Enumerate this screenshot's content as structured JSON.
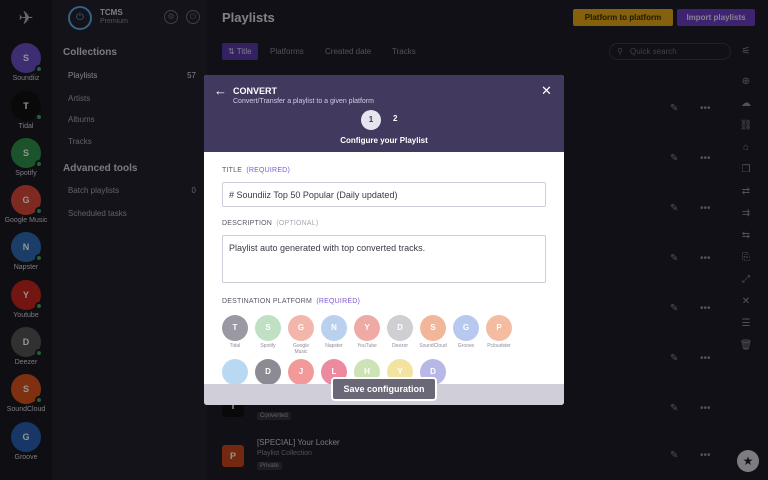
{
  "rail": {
    "items": [
      {
        "letter": "S",
        "label": "Soundiiz",
        "color": "#6b4fc4"
      },
      {
        "letter": "T",
        "label": "Tidal",
        "color": "#111111"
      },
      {
        "letter": "S",
        "label": "Spotify",
        "color": "#2f8f4a"
      },
      {
        "letter": "G",
        "label": "Google Music",
        "color": "#d9493a"
      },
      {
        "letter": "N",
        "label": "Napster",
        "color": "#2d6cb3"
      },
      {
        "letter": "Y",
        "label": "Youtube",
        "color": "#c6251e"
      },
      {
        "letter": "D",
        "label": "Deezer",
        "color": "#555555"
      },
      {
        "letter": "S",
        "label": "SoundCloud",
        "color": "#d9531e"
      },
      {
        "letter": "G",
        "label": "Groove",
        "color": "#2a5db0"
      }
    ]
  },
  "brand": {
    "title": "TCMS",
    "subtitle": "Premium"
  },
  "collections": {
    "heading": "Collections",
    "items": [
      {
        "label": "Playlists",
        "count": "57"
      },
      {
        "label": "Artists",
        "count": ""
      },
      {
        "label": "Albums",
        "count": ""
      },
      {
        "label": "Tracks",
        "count": ""
      }
    ]
  },
  "advanced": {
    "heading": "Advanced tools",
    "items": [
      {
        "label": "Batch playlists",
        "count": "0"
      },
      {
        "label": "Scheduled tasks",
        "count": ""
      }
    ]
  },
  "main": {
    "title": "Playlists",
    "btn_platform": "Platform to platform",
    "btn_import": "Import playlists",
    "tabs": [
      "Title",
      "Platforms",
      "Created date",
      "Tracks"
    ],
    "search_placeholder": "Quick search",
    "rows": [
      {
        "letter": "T",
        "color": "#111111",
        "title": "",
        "sub": "",
        "tag": "Converted"
      },
      {
        "letter": "P",
        "color": "#c9461d",
        "title": "[SPECIAL] Your Locker",
        "sub": "Playlist Collection",
        "tag": "Private"
      }
    ]
  },
  "modal": {
    "title": "CONVERT",
    "subtitle": "Convert/Transfer a playlist to a given platform",
    "step1": "1",
    "step2": "2",
    "step_label": "Configure your Playlist",
    "title_label": "TITLE",
    "title_req": "(REQUIRED)",
    "title_value": "# Soundiiz Top 50 Popular (Daily updated)",
    "desc_label": "DESCRIPTION",
    "desc_opt": "(OPTIONAL)",
    "desc_value": "Playlist auto generated with top converted tracks.",
    "dest_label": "DESTINATION PLATFORM",
    "dest_req": "(REQUIRED)",
    "platforms_row1": [
      {
        "letter": "T",
        "label": "Tidal",
        "color": "#9a99a3"
      },
      {
        "letter": "S",
        "label": "Spotify",
        "color": "#bfe0c3"
      },
      {
        "letter": "G",
        "label": "Google Music",
        "color": "#f3b6aa"
      },
      {
        "letter": "N",
        "label": "Napster",
        "color": "#b9d0ef"
      },
      {
        "letter": "Y",
        "label": "YouTube",
        "color": "#f0aaa6"
      },
      {
        "letter": "D",
        "label": "Deezer",
        "color": "#cfcfd3"
      },
      {
        "letter": "S",
        "label": "SoundCloud",
        "color": "#f2b79b"
      },
      {
        "letter": "G",
        "label": "Groove",
        "color": "#b7c9ee"
      },
      {
        "letter": "P",
        "label": "Pcloudster",
        "color": "#f4bda2"
      }
    ],
    "platforms_row2": [
      {
        "letter": "",
        "color": "#b9d9f2"
      },
      {
        "letter": "D",
        "color": "#8c8b94"
      },
      {
        "letter": "J",
        "color": "#f29a9a"
      },
      {
        "letter": "L",
        "color": "#ee8aa0"
      },
      {
        "letter": "H",
        "color": "#cde3b6"
      },
      {
        "letter": "Y",
        "color": "#f3e3a2"
      },
      {
        "letter": "D",
        "color": "#b8b8e8"
      }
    ],
    "save_label": "Save configuration"
  }
}
